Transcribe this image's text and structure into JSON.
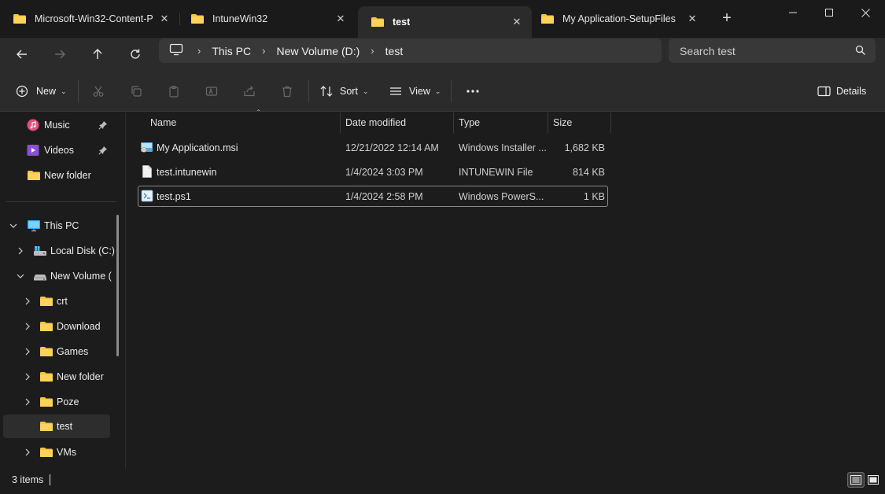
{
  "tabs": [
    {
      "label": "Microsoft-Win32-Content-P",
      "active": false
    },
    {
      "label": "IntuneWin32",
      "active": false
    },
    {
      "label": "test",
      "active": true
    },
    {
      "label": "My Application-SetupFiles",
      "active": false
    }
  ],
  "tab_close_glyph": "✕",
  "new_tab_glyph": "+",
  "breadcrumb": [
    "This PC",
    "New Volume (D:)",
    "test"
  ],
  "search": {
    "placeholder": "Search test"
  },
  "commands": {
    "new": "New",
    "sort": "Sort",
    "view": "View",
    "details": "Details"
  },
  "sidebar": {
    "quick_access": [
      {
        "label": "Music",
        "icon": "music-icon",
        "pinned": true
      },
      {
        "label": "Videos",
        "icon": "videos-icon",
        "pinned": true
      },
      {
        "label": "New folder",
        "icon": "folder-icon",
        "pinned": false
      }
    ],
    "this_pc": {
      "label": "This PC"
    },
    "drives": [
      {
        "label": "Local Disk (C:)",
        "expanded": false
      },
      {
        "label": "New Volume (I",
        "expanded": true
      }
    ],
    "folders": [
      {
        "label": "crt"
      },
      {
        "label": "Download"
      },
      {
        "label": "Games"
      },
      {
        "label": "New folder"
      },
      {
        "label": "Poze"
      },
      {
        "label": "test",
        "selected": true
      },
      {
        "label": "VMs"
      }
    ]
  },
  "columns": {
    "name": "Name",
    "date": "Date modified",
    "type": "Type",
    "size": "Size"
  },
  "files": [
    {
      "name": "My Application.msi",
      "date": "12/21/2022 12:14 AM",
      "type": "Windows Installer ...",
      "size": "1,682 KB",
      "icon": "msi-file-icon"
    },
    {
      "name": "test.intunewin",
      "date": "1/4/2024 3:03 PM",
      "type": "INTUNEWIN File",
      "size": "814 KB",
      "icon": "generic-file-icon"
    },
    {
      "name": "test.ps1",
      "date": "1/4/2024 2:58 PM",
      "type": "Windows PowerS...",
      "size": "1 KB",
      "icon": "powershell-file-icon"
    }
  ],
  "status": {
    "item_count": "3 items"
  },
  "colors": {
    "folder": "#f6c445",
    "accent": "#4cc2ff",
    "background": "#1c1c1c"
  }
}
